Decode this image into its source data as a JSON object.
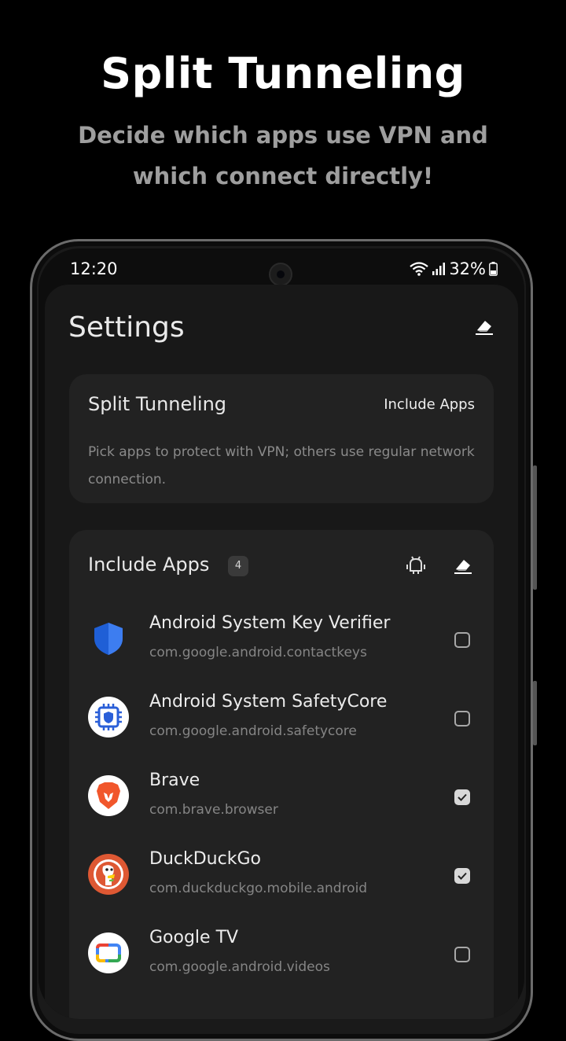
{
  "promo": {
    "title": "Split Tunneling",
    "subtitle_line1": "Decide which apps use VPN and",
    "subtitle_line2": "which connect directly!"
  },
  "status_bar": {
    "time": "12:20",
    "battery": "32%"
  },
  "header": {
    "title": "Settings",
    "clear_icon": "eraser-icon"
  },
  "split_card": {
    "title": "Split Tunneling",
    "mode_label": "Include Apps",
    "description": "Pick apps to protect with VPN; others use regular network connection."
  },
  "apps_card": {
    "title": "Include Apps",
    "count": "4",
    "system_icon": "android-icon",
    "clear_icon": "eraser-icon",
    "apps": [
      {
        "name": "Android System Key Verifier",
        "package": "com.google.android.contactkeys",
        "checked": false,
        "icon": "shield-icon"
      },
      {
        "name": "Android System SafetyCore",
        "package": "com.google.android.safetycore",
        "checked": false,
        "icon": "chip-shield-icon"
      },
      {
        "name": "Brave",
        "package": "com.brave.browser",
        "checked": true,
        "icon": "brave-lion-icon"
      },
      {
        "name": "DuckDuckGo",
        "package": "com.duckduckgo.mobile.android",
        "checked": true,
        "icon": "duck-icon"
      },
      {
        "name": "Google TV",
        "package": "com.google.android.videos",
        "checked": false,
        "icon": "tv-icon"
      }
    ]
  },
  "colors": {
    "background": "#000000",
    "card": "#222222",
    "accent_brave": "#f1562b",
    "accent_ddg": "#de5833"
  }
}
